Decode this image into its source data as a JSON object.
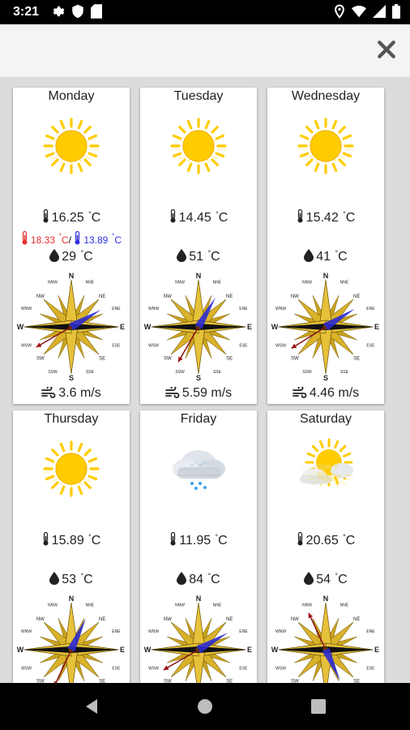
{
  "status_bar": {
    "time": "3:21"
  },
  "forecast": [
    {
      "day": "Monday",
      "condition": "sunny",
      "temp": "16.25",
      "unit": "°C",
      "max": "18.33",
      "min": "13.89",
      "show_minmax": true,
      "humidity": "29",
      "wind_speed": "3.6 m/s",
      "wind_dir_deg": 60
    },
    {
      "day": "Tuesday",
      "condition": "sunny",
      "temp": "14.45",
      "unit": "°C",
      "max": "",
      "min": "",
      "show_minmax": false,
      "humidity": "51",
      "wind_speed": "5.59 m/s",
      "wind_dir_deg": 30
    },
    {
      "day": "Wednesday",
      "condition": "sunny",
      "temp": "15.42",
      "unit": "°C",
      "max": "",
      "min": "",
      "show_minmax": false,
      "humidity": "41",
      "wind_speed": "4.46 m/s",
      "wind_dir_deg": 58
    },
    {
      "day": "Thursday",
      "condition": "sunny",
      "temp": "15.89",
      "unit": "°C",
      "max": "",
      "min": "",
      "show_minmax": false,
      "humidity": "53",
      "wind_speed": "",
      "wind_dir_deg": 25
    },
    {
      "day": "Friday",
      "condition": "rain",
      "temp": "11.95",
      "unit": "°C",
      "max": "",
      "min": "",
      "show_minmax": false,
      "humidity": "84",
      "wind_speed": "",
      "wind_dir_deg": 60
    },
    {
      "day": "Saturday",
      "condition": "partly-cloudy",
      "temp": "20.65",
      "unit": "°C",
      "max": "",
      "min": "",
      "show_minmax": false,
      "humidity": "54",
      "wind_speed": "",
      "wind_dir_deg": 155
    }
  ],
  "compass_labels": {
    "n": "N",
    "s": "S",
    "e": "E",
    "w": "W",
    "ne": "NE",
    "nw": "NW",
    "se": "SE",
    "sw": "SW",
    "nne": "NNE",
    "nnw": "NNW",
    "ene": "ENE",
    "ese": "ESE",
    "sse": "SSE",
    "ssw": "SSW",
    "wsw": "WSW",
    "wnw": "WNW"
  },
  "icons": {
    "close": "close-icon",
    "temperature": "thermometer-icon",
    "humidity": "drop-icon",
    "wind": "wind-icon"
  },
  "colors": {
    "max_temp": "#e8312f",
    "min_temp": "#3030e0",
    "sun": "#ffcc00",
    "arrow": "#2a2ad0"
  }
}
